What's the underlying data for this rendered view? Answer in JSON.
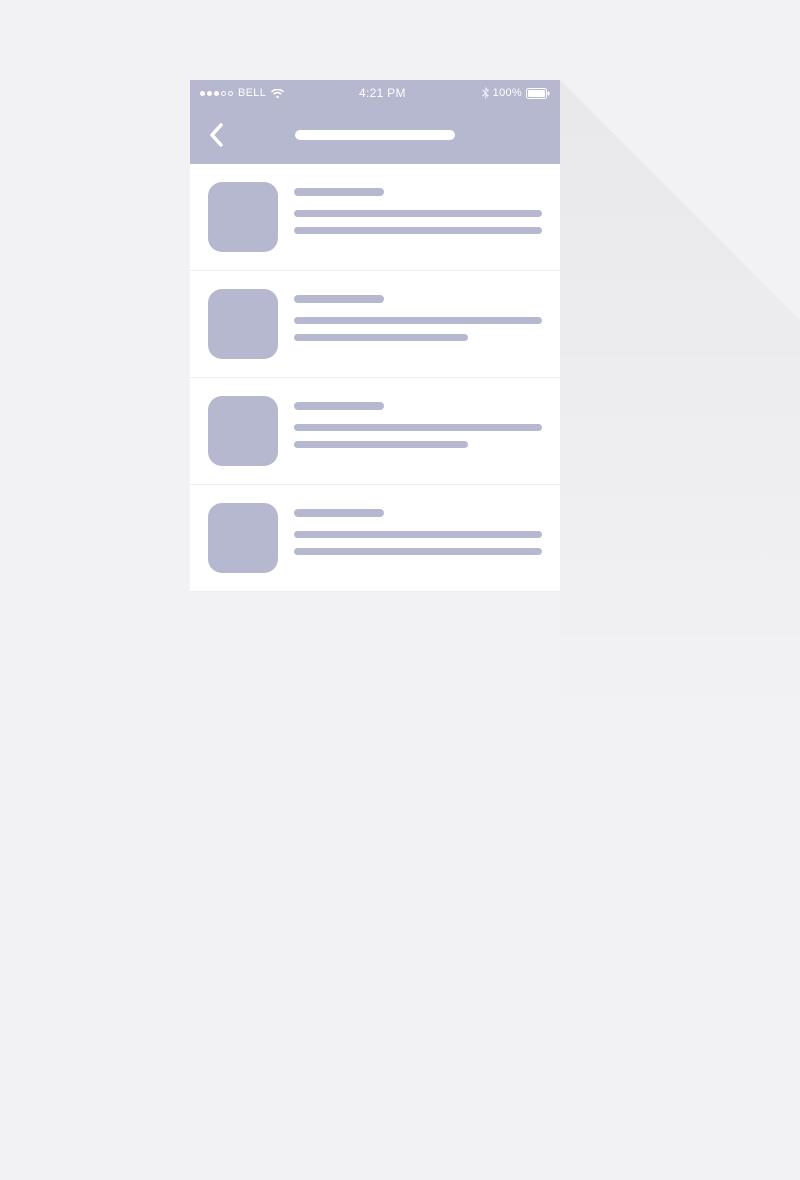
{
  "status_bar": {
    "carrier": "BELL",
    "signal_filled": 3,
    "signal_total": 5,
    "time": "4:21 PM",
    "battery_percent": "100%"
  },
  "nav": {
    "back_label": "Back",
    "title_placeholder": ""
  },
  "list": {
    "items": [
      {
        "title_placeholder": "",
        "line2_variant": "long"
      },
      {
        "title_placeholder": "",
        "line2_variant": "mid"
      },
      {
        "title_placeholder": "",
        "line2_variant": "mid"
      },
      {
        "title_placeholder": "",
        "line2_variant": "long"
      }
    ]
  },
  "colors": {
    "accent": "#b5b8cf",
    "bg": "#f2f2f4",
    "divider": "#ededf0"
  }
}
